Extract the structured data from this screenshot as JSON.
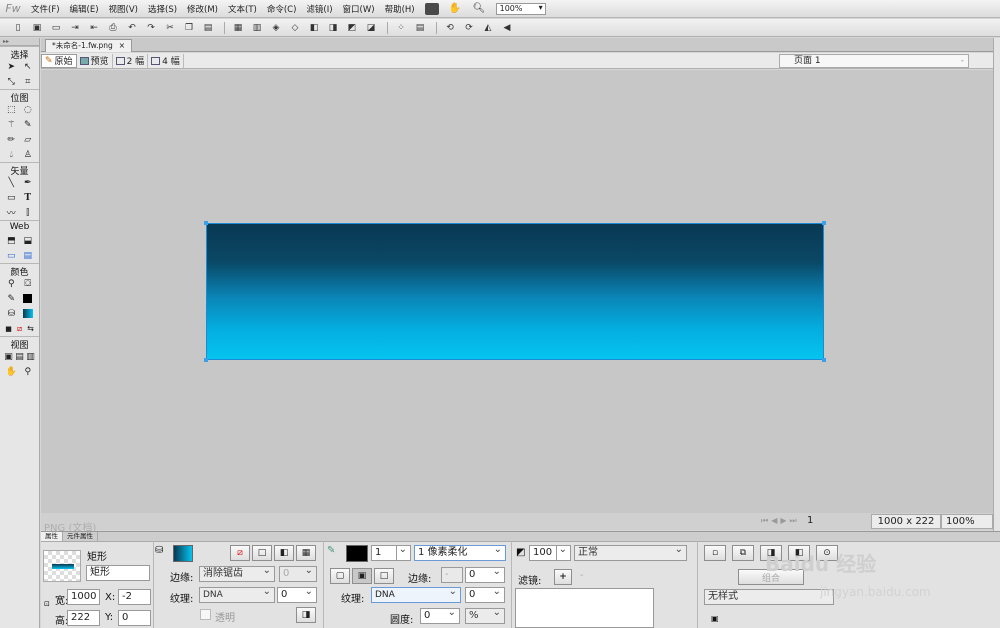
{
  "app": {
    "logo": "Fw"
  },
  "menu": [
    "文件(F)",
    "编辑(E)",
    "视图(V)",
    "选择(S)",
    "修改(M)",
    "文本(T)",
    "命令(C)",
    "滤镜(I)",
    "窗口(W)",
    "帮助(H)"
  ],
  "menu_zoom": "100%",
  "document": {
    "tab_title": "*未命名-1.fw.png",
    "close_glyph": "×"
  },
  "view_tabs": [
    "原始",
    "预览",
    "2 幅",
    "4 幅"
  ],
  "page_selector": "页面 1",
  "tools": {
    "sections": [
      "选择",
      "位图",
      "矢量",
      "Web",
      "颜色",
      "视图"
    ]
  },
  "canvas": {
    "rect_gradient": [
      "#093852",
      "#0a4866",
      "#0a86b8",
      "#04aee0",
      "#05c4ef"
    ],
    "selection_color": "#1c8ad4"
  },
  "status": {
    "watermark": "PNG (文档)",
    "page_number": "1",
    "doc_size": "1000 x 222",
    "zoom": "100%"
  },
  "properties": {
    "tabs": [
      "属性",
      "元件属性"
    ],
    "object_type": "矩形",
    "object_name": "矩形",
    "width_label": "宽:",
    "width": "1000",
    "height_label": "高:",
    "height": "222",
    "x_label": "X:",
    "x": "-2",
    "y_label": "Y:",
    "y": "0",
    "fill": {
      "edge_label": "边缘:",
      "edge_value": "消除锯齿",
      "edge_amount": "0",
      "texture_label": "纹理:",
      "texture_value": "DNA",
      "texture_amount": "0",
      "transparent_label": "透明"
    },
    "stroke": {
      "size": "1",
      "type": "1 像素柔化",
      "edge_label": "边缘:",
      "edge_amount": "0",
      "texture_label": "纹理:",
      "texture_value": "DNA",
      "texture_amount": "0",
      "roundness_label": "圆度:",
      "roundness_value": "0",
      "roundness_unit": "%"
    },
    "opacity": "100",
    "blend_mode": "正常",
    "filters_label": "滤镜:",
    "group_label": "组合",
    "style_value": "无样式"
  },
  "watermark": {
    "baidu": "Baidu 经验",
    "url": "jingyan.baidu.com"
  }
}
